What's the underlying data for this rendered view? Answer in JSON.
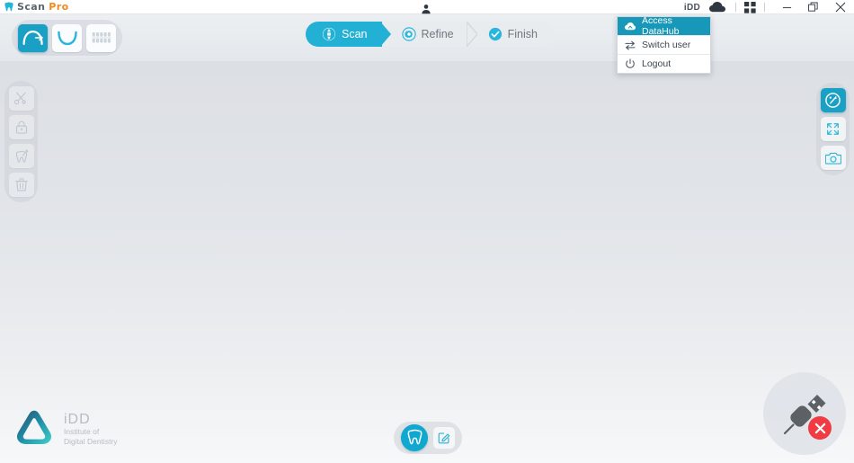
{
  "app": {
    "brand_scan": "Scan",
    "brand_pro": "Pro",
    "tooth_icon": "tooth-icon",
    "accent_teal": "#19a0c4",
    "accent_step": "#22b0d4",
    "accent_orange": "#f08a1e",
    "error_red": "#ef3b41"
  },
  "titlebar": {
    "person_icon": "person-icon",
    "account_label": "iDD",
    "cloud_icon": "cloud-icon",
    "grid_icon": "grid-icon",
    "minimize_label": "–",
    "restore_label": "❐",
    "close_label": "✕"
  },
  "arch_toolbar": {
    "items": [
      {
        "label": "Upper arch",
        "icon": "upper-arch-icon",
        "active": true
      },
      {
        "label": "Lower arch",
        "icon": "lower-arch-icon",
        "active": false
      },
      {
        "label": "Bite",
        "icon": "bite-icon",
        "active": false
      }
    ]
  },
  "steps": [
    {
      "label": "Scan",
      "icon": "scan-icon",
      "active": true
    },
    {
      "label": "Refine",
      "icon": "gear-icon",
      "active": false
    },
    {
      "label": "Finish",
      "icon": "check-icon",
      "active": false
    }
  ],
  "dropdown": {
    "items": [
      {
        "label": "Access DataHub",
        "icon": "cloud-up-icon",
        "selected": true
      },
      {
        "label": "Switch user",
        "icon": "switch-user-icon",
        "selected": false
      },
      {
        "label": "Logout",
        "icon": "power-icon",
        "selected": false
      }
    ]
  },
  "left_tools": [
    {
      "label": "Trim / Cut",
      "icon": "scissors-icon"
    },
    {
      "label": "Lock",
      "icon": "lock-icon"
    },
    {
      "label": "Clean tooth",
      "icon": "tooth-brush-icon"
    },
    {
      "label": "Delete",
      "icon": "trash-icon"
    }
  ],
  "right_tools": [
    {
      "label": "Color / Texture",
      "icon": "palette-icon",
      "active": true
    },
    {
      "label": "Fullscreen",
      "icon": "expand-icon",
      "active": false
    },
    {
      "label": "Screenshot",
      "icon": "camera-icon",
      "active": false
    }
  ],
  "bottom_bar": {
    "scan_button": {
      "label": "Scan object",
      "icon": "tooth-icon"
    },
    "edit_button": {
      "label": "Edit",
      "icon": "edit-square-icon"
    }
  },
  "device_status": {
    "icon": "usb-plug-icon",
    "badge_icon": "error-x-icon",
    "state": "disconnected"
  },
  "footer_logo": {
    "mark": "idd-triangle-icon",
    "title": "iDD",
    "line1": "Institute of",
    "line2": "Digital Dentistry"
  }
}
